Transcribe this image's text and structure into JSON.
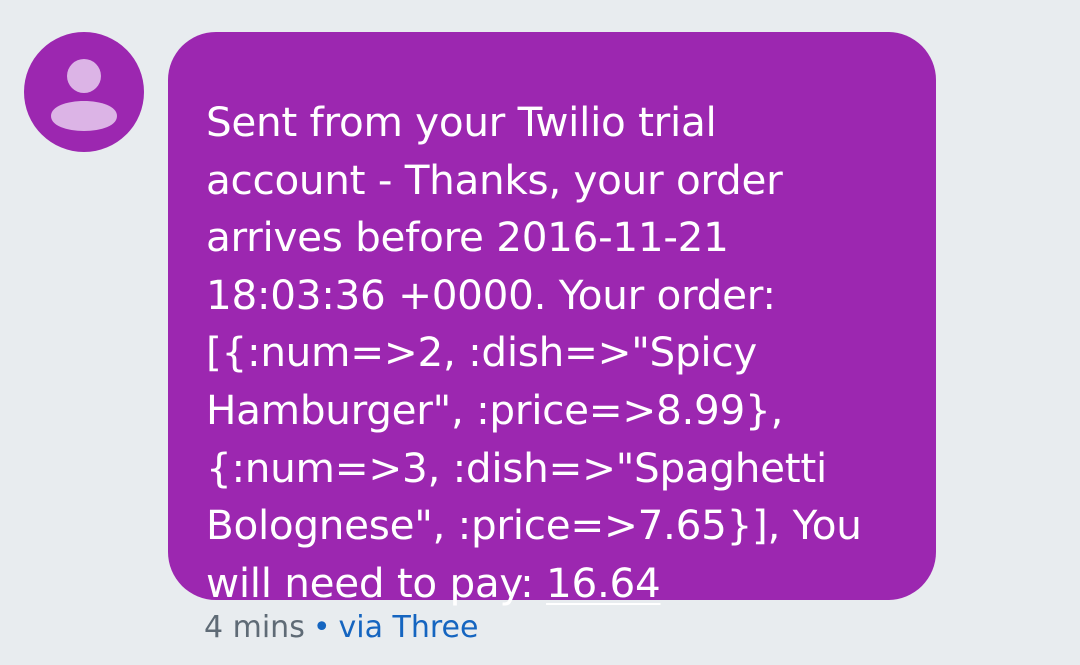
{
  "message": {
    "lines": [
      "Sent from your Twilio trial",
      "account - Thanks, your order",
      "arrives before 2016-11-21",
      "18:03:36 +0000. Your order:",
      "[{:num=>2, :dish=>\"Spicy",
      "Hamburger\", :price=>8.99},",
      "{:num=>3, :dish=>\"Spaghetti",
      "Bolognese\", :price=>7.65}], You"
    ],
    "last_line_prefix": "will need to pay: ",
    "amount_link": "16.64"
  },
  "meta": {
    "time": "4 mins",
    "separator": "•",
    "via": "via Three"
  },
  "colors": {
    "bubble": "#9c27b0",
    "background": "#e8ecef",
    "link_blue": "#1565c0",
    "meta_gray": "#5f6b76"
  },
  "icons": {
    "avatar": "person-icon"
  }
}
